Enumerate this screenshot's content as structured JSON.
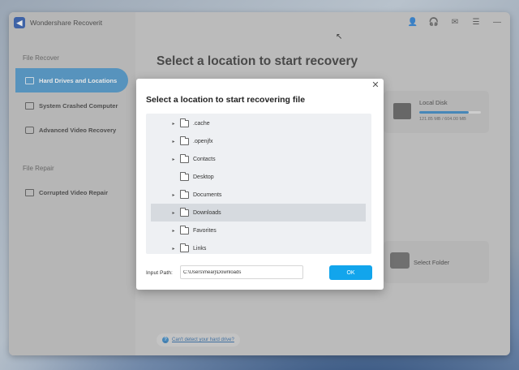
{
  "app": {
    "title": "Wondershare Recoverit",
    "logo_glyph": "◀"
  },
  "titlebar": {
    "icons": [
      "user-icon",
      "headset-icon",
      "mail-icon",
      "menu-icon",
      "minimize-icon"
    ],
    "glyphs": [
      "👤",
      "🎧",
      "✉",
      "☰",
      "—"
    ]
  },
  "sidebar": {
    "file_recover_label": "File Recover",
    "file_repair_label": "File Repair",
    "items": [
      {
        "label": "Hard Drives and Locations",
        "active": true
      },
      {
        "label": "System Crashed Computer",
        "active": false
      },
      {
        "label": "Advanced Video Recovery",
        "active": false
      }
    ],
    "repair_items": [
      {
        "label": "Corrupted Video Repair"
      }
    ]
  },
  "main": {
    "heading": "Select a location to start recovery",
    "drive": {
      "name": "Local Disk",
      "size": "121.85 MB / 604.00 MB",
      "used_fraction": 0.8
    },
    "select_folder_label": "Select Folder",
    "help_text": "Can't detect your hard drive?",
    "help_glyph": "?"
  },
  "dialog": {
    "title": "Select a location to start recovering file",
    "close_glyph": "✕",
    "tree": [
      {
        "name": ".cache",
        "expandable": true,
        "selected": false
      },
      {
        "name": ".openjfx",
        "expandable": true,
        "selected": false
      },
      {
        "name": "Contacts",
        "expandable": true,
        "selected": false
      },
      {
        "name": "Desktop",
        "expandable": false,
        "selected": false
      },
      {
        "name": "Documents",
        "expandable": true,
        "selected": false
      },
      {
        "name": "Downloads",
        "expandable": true,
        "selected": true
      },
      {
        "name": "Favorites",
        "expandable": true,
        "selected": false
      },
      {
        "name": "Links",
        "expandable": true,
        "selected": false
      }
    ],
    "input_label": "Input Path:",
    "input_value": "C:\\Users\\mearj\\Downloads",
    "ok_label": "OK"
  },
  "colors": {
    "accent": "#12a5ec",
    "active_nav": "#3f8fc7",
    "brand": "#1f4fa8"
  }
}
